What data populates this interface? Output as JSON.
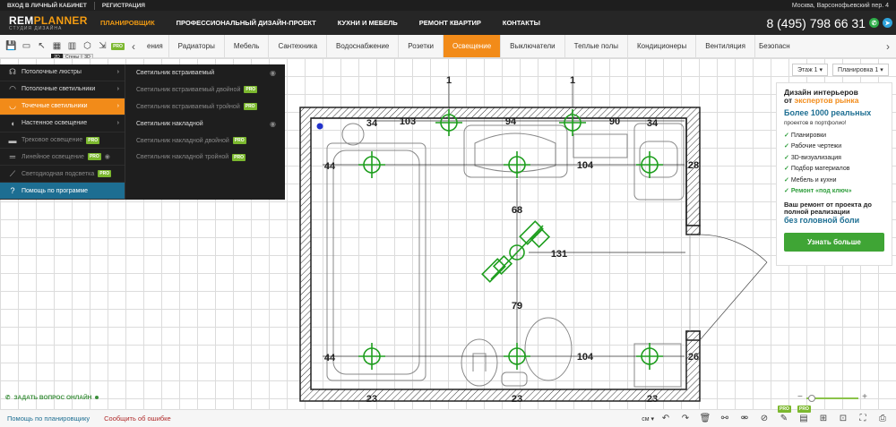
{
  "topbar": {
    "login": "ВХОД В ЛИЧНЫЙ КАБИНЕТ",
    "register": "РЕГИСТРАЦИЯ",
    "address": "Москва, Варсонофьевский пер. 4"
  },
  "header": {
    "logo_a": "REM",
    "logo_b": "PLANNER",
    "logo_sub": "СТУДИЯ ДИЗАЙНА",
    "nav": [
      "ПЛАНИРОВЩИК",
      "ПРОФЕССИОНАЛЬНЫЙ ДИЗАЙН-ПРОЕКТ",
      "КУХНИ И МЕБЕЛЬ",
      "РЕМОНТ КВАРТИР",
      "КОНТАКТЫ"
    ],
    "phone": "8 (495) 798 66 31"
  },
  "toolbar": {
    "tag_2d": "2D",
    "tag_walls": "Стены",
    "tag_3d": "3D",
    "pro": "PRO",
    "cats": [
      "ения",
      "Радиаторы",
      "Мебель",
      "Сантехника",
      "Водоснабжение",
      "Розетки",
      "Освещение",
      "Выключатели",
      "Теплые полы",
      "Кондиционеры",
      "Вентиляция",
      "Безопасн"
    ]
  },
  "menu": {
    "left": [
      {
        "label": "Потолочные люстры",
        "icon": "chandelier-icon"
      },
      {
        "label": "Потолочные светильники",
        "icon": "ceiling-light-icon"
      },
      {
        "label": "Точечные светильники",
        "icon": "spotlight-icon"
      },
      {
        "label": "Настенное освещение",
        "icon": "wall-light-icon"
      },
      {
        "label": "Трековое освещение",
        "icon": "track-light-icon"
      },
      {
        "label": "Линейное освещение",
        "icon": "linear-light-icon"
      },
      {
        "label": "Светодиодная подсветка",
        "icon": "led-strip-icon"
      },
      {
        "label": "Помощь по программе",
        "icon": "help-icon"
      }
    ],
    "right": [
      "Светильник встраиваемый",
      "Светильник встраиваемый двойной",
      "Светильник встраиваемый тройной",
      "Светильник накладной",
      "Светильник накладной двойной",
      "Светильник накладной тройной"
    ]
  },
  "floors": {
    "floor": "Этаж 1",
    "layout": "Планировка 1"
  },
  "ad": {
    "t1": "Дизайн интерьеров",
    "t2a": "от ",
    "t2b": "экспертов рынка",
    "big": "Более 1000 реальных",
    "sub": "проектов в портфолио!",
    "list": [
      "Планировки",
      "Рабочие чертежи",
      "3D-визуализация",
      "Подбор материалов",
      "Мебель и кухни",
      "Ремонт «под ключ»"
    ],
    "b1": "Ваш ремонт от проекта до полной реализации",
    "b2": "без головной боли",
    "cta": "Узнать больше"
  },
  "chat": "ЗАДАТЬ ВОПРОС ОНЛАЙН",
  "footer": {
    "help": "Помощь по планировщику",
    "bug": "Сообщить об ошибке",
    "unit": "см"
  },
  "plan": {
    "dims": {
      "top_l": "34",
      "top_m1": "103",
      "top_m2": "94",
      "top_m3": "90",
      "top_r": "34",
      "left_u": "44",
      "left_d": "44",
      "mid_r": "104",
      "mid_r2": "104",
      "v1": "68",
      "v2": "79",
      "diag": "131",
      "right_u": "28",
      "right_d": "26",
      "bot_l": "23",
      "bot_m": "23",
      "bot_r": "23",
      "above_1": "1",
      "above_2": "1"
    }
  }
}
